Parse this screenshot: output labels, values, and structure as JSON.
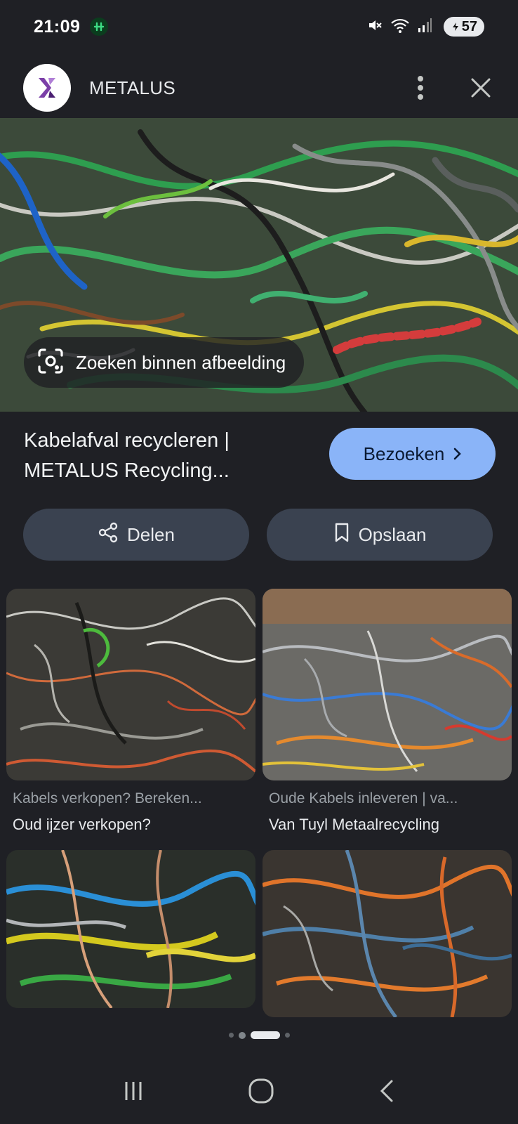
{
  "status": {
    "time": "21:09",
    "battery": "57"
  },
  "header": {
    "site_name": "METALUS"
  },
  "hero": {
    "lens_label": "Zoeken binnen afbeelding"
  },
  "result": {
    "title_line1": "Kabelafval recycleren |",
    "title_line2": "METALUS Recycling...",
    "visit_label": "Bezoeken"
  },
  "actions": {
    "share_label": "Delen",
    "save_label": "Opslaan"
  },
  "related": [
    {
      "title": "Kabels verkopen? Bereken...",
      "source": "Oud ijzer verkopen?"
    },
    {
      "title": "Oude Kabels inleveren | va...",
      "source": "Van Tuyl Metaalrecycling"
    },
    {
      "title": "",
      "source": ""
    },
    {
      "title": "",
      "source": ""
    }
  ],
  "colors": {
    "background": "#1f2025",
    "accent": "#8ab4f8",
    "pill": "#3a4250"
  },
  "icons": [
    "app-notification-icon",
    "mute-icon",
    "wifi-icon",
    "signal-icon",
    "more-vert-icon",
    "close-icon",
    "lens-icon",
    "chevron-right-icon",
    "share-icon",
    "bookmark-icon",
    "recents-icon",
    "home-icon",
    "back-icon"
  ]
}
